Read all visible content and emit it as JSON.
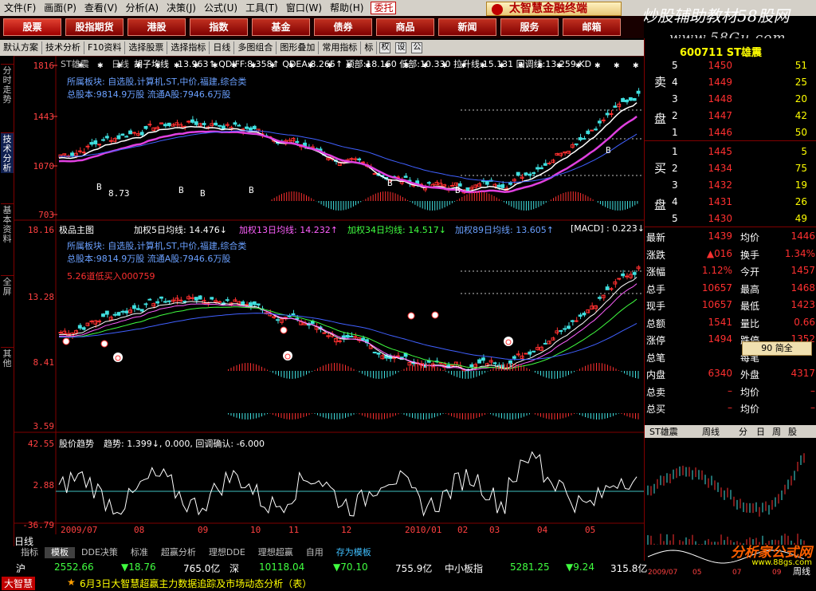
{
  "menu": [
    "文件(F)",
    "画面(P)",
    "查看(V)",
    "分析(A)",
    "决策(J)",
    "公式(U)",
    "工具(T)",
    "窗口(W)",
    "帮助(H)",
    "委托"
  ],
  "brand": "太智慧金融终端",
  "watermark": "炒股辅助教材58股网",
  "watermark_url": "www.58Gu.com",
  "nav": [
    "股票",
    "股指期货",
    "港股",
    "指数",
    "基金",
    "债券",
    "商品",
    "新闻",
    "服务",
    "邮箱"
  ],
  "toolbar": [
    "默认方案",
    "技术分析",
    "F10资料",
    "选择股票",
    "选择指标",
    "日线",
    "多图组合",
    "图形叠加",
    "常用指标",
    "标",
    "权",
    "设",
    "公"
  ],
  "left_tabs": [
    "分时走势",
    "技术分析",
    "基本资料",
    "全屏",
    "其他"
  ],
  "main": {
    "stock": "ST雄震",
    "period": "日线",
    "ind_name": "胡子均线",
    "ind_vals": "13.963↑ QDIFF:8.358↑ QDEA:8.265↑ 顶部:18.160 低部:10.330 拉升线:15.131 回调线:13.259 KD",
    "sector": "所属板块: 自选股,计算机,ST,中价,福建,综合类",
    "capital": "总股本:9814.9万股  流通A股:7946.6万股",
    "yticks": [
      "1816",
      "1443",
      "1070",
      "703"
    ],
    "b_labels": [
      "B",
      "B",
      "B",
      "B",
      "B",
      "B",
      "B"
    ],
    "b_note": "8.73"
  },
  "sub": {
    "title": "极品主图",
    "ma5": "加权5日均线: 14.476↓",
    "ma13": "加权13日均线: 14.232↑",
    "ma34": "加权34日均线: 14.517↓",
    "ma89": "加权89日均线: 13.605↑",
    "macd": "[MACD] : 0.223↓",
    "signal": "5.26道低买入000759",
    "yticks": [
      "18.16",
      "13.28",
      "8.41",
      "3.59"
    ]
  },
  "trend": {
    "title": "股价趋势",
    "vals": "趋势: 1.399↓, 0.000, 回调确认: -6.000",
    "yticks": [
      "42.55",
      "2.88",
      "-36.79"
    ]
  },
  "xaxis": [
    "2009/07",
    "08",
    "09",
    "10",
    "11",
    "12",
    "2010/01",
    "02",
    "03",
    "04",
    "05"
  ],
  "period_label": "日线",
  "bottom_tabs": [
    "指标",
    "模板",
    "DDE决策",
    "标准",
    "超赢分析",
    "理想DDE",
    "理想超赢",
    "自用",
    "存为模板"
  ],
  "ticker": {
    "sh_label": "沪",
    "sh_idx": "2552.66",
    "sh_chg": "▼18.76",
    "sh_amt": "765.0亿",
    "sz_label": "深",
    "sz_idx": "10118.04",
    "sz_chg": "▼70.10",
    "sz_amt": "755.9亿",
    "zx_label": "中小板指",
    "zx_idx": "5281.25",
    "zx_chg": "▼9.24",
    "zx_amt": "315.8亿"
  },
  "news": {
    "logo": "大智慧",
    "text": "6月3日大智慧超赢主力数据追踪及市场动态分析（表）"
  },
  "right": {
    "code": "600711 ST雄震",
    "sell": [
      {
        "n": "5",
        "p": "1450",
        "v": "51"
      },
      {
        "n": "4",
        "p": "1449",
        "v": "25"
      },
      {
        "n": "3",
        "p": "1448",
        "v": "20"
      },
      {
        "n": "2",
        "p": "1447",
        "v": "42"
      },
      {
        "n": "1",
        "p": "1446",
        "v": "50"
      }
    ],
    "buy": [
      {
        "n": "1",
        "p": "1445",
        "v": "5"
      },
      {
        "n": "2",
        "p": "1434",
        "v": "75"
      },
      {
        "n": "3",
        "p": "1432",
        "v": "19"
      },
      {
        "n": "4",
        "p": "1431",
        "v": "26"
      },
      {
        "n": "5",
        "p": "1430",
        "v": "49"
      }
    ],
    "sell_label": [
      "卖",
      "盘"
    ],
    "buy_label": [
      "买",
      "盘"
    ],
    "stats": [
      [
        "最新",
        "1439",
        "均价",
        "1446"
      ],
      [
        "涨跌",
        "▲016",
        "换手",
        "1.34%"
      ],
      [
        "涨幅",
        "1.12%",
        "今开",
        "1457"
      ],
      [
        "总手",
        "10657",
        "最高",
        "1468"
      ],
      [
        "现手",
        "10657",
        "最低",
        "1423"
      ],
      [
        "总额",
        "1541",
        "量比",
        "0.66"
      ],
      [
        "涨停",
        "1494",
        "跌停",
        "1352"
      ],
      [
        "总笔",
        "",
        "每笔",
        ""
      ],
      [
        "内盘",
        "6340",
        "外盘",
        "4317"
      ],
      [
        "总卖",
        "–",
        "均价",
        "–"
      ],
      [
        "总买",
        "–",
        "均价",
        "–"
      ]
    ],
    "popup": "90 简全",
    "mini_tabs": [
      "ST雄震",
      "周线",
      "分",
      "日",
      "周",
      "股"
    ],
    "mini_x": [
      "2009/07",
      "05",
      "07",
      "09"
    ],
    "mini_week": "周线",
    "footer": "分析家公式网",
    "footer_url": "www.88gs.com"
  }
}
